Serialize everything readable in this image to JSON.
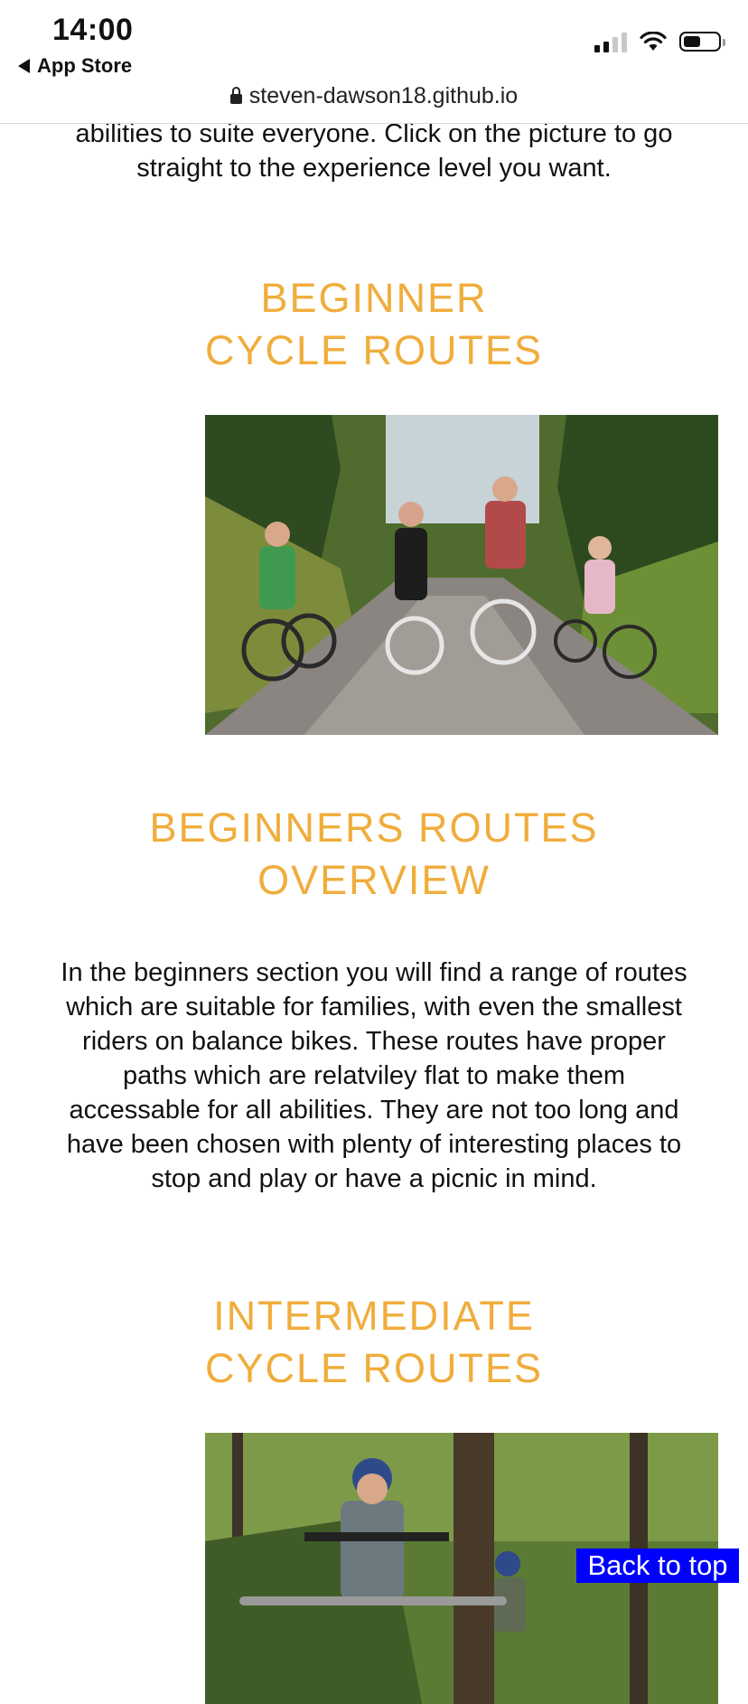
{
  "status_bar": {
    "time": "14:00",
    "back_app": "App Store",
    "url": "steven-dawson18.github.io"
  },
  "intro_text": "abilities to suite everyone. Click on the picture to go straight to the experience level you want.",
  "beginner": {
    "heading_line1": "BEGINNER",
    "heading_line2": "CYCLE ROUTES"
  },
  "overview": {
    "heading_line1": "BEGINNERS ROUTES",
    "heading_line2": "OVERVIEW",
    "text": "In the beginners section you will find a range of routes which are suitable for families, with even the smallest riders on balance bikes. These routes have proper paths which are relatviley flat to make them accessable for all abilities. They are not too long and have been chosen with plenty of interesting places to stop and play or have a picnic in mind."
  },
  "intermediate": {
    "heading_line1": "INTERMEDIATE",
    "heading_line2": "CYCLE ROUTES"
  },
  "back_to_top": "Back to top",
  "colors": {
    "heading": "#f0ad3c",
    "back_to_top_bg": "#0000ff"
  }
}
